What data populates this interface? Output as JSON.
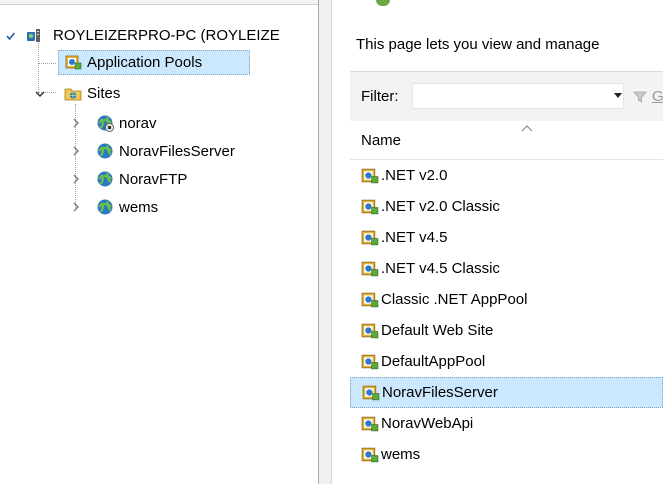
{
  "tree": {
    "server_label": "ROYLEIZERPRO-PC (ROYLEIZE",
    "app_pools_label": "Application Pools",
    "sites_label": "Sites",
    "sites": [
      {
        "label": "norav",
        "icon": "site-stopped-icon"
      },
      {
        "label": "NoravFilesServer",
        "icon": "globe-icon"
      },
      {
        "label": "NoravFTP",
        "icon": "globe-icon"
      },
      {
        "label": "wems",
        "icon": "globe-icon"
      }
    ]
  },
  "content": {
    "description": "This page lets you view and manage",
    "filter": {
      "label": "Filter:",
      "value": "",
      "go_label": "Go"
    },
    "columns": [
      "Name"
    ],
    "app_pools": [
      {
        "name": ".NET v2.0"
      },
      {
        "name": ".NET v2.0 Classic"
      },
      {
        "name": ".NET v4.5"
      },
      {
        "name": ".NET v4.5 Classic"
      },
      {
        "name": "Classic .NET AppPool"
      },
      {
        "name": "Default Web Site"
      },
      {
        "name": "DefaultAppPool"
      },
      {
        "name": "NoravFilesServer",
        "selected": true
      },
      {
        "name": "NoravWebApi"
      },
      {
        "name": "wems"
      }
    ]
  },
  "colors": {
    "selection": "#cce8ff",
    "selection_border": "#7da2ce",
    "tree_accent": "#1f5ea8"
  }
}
